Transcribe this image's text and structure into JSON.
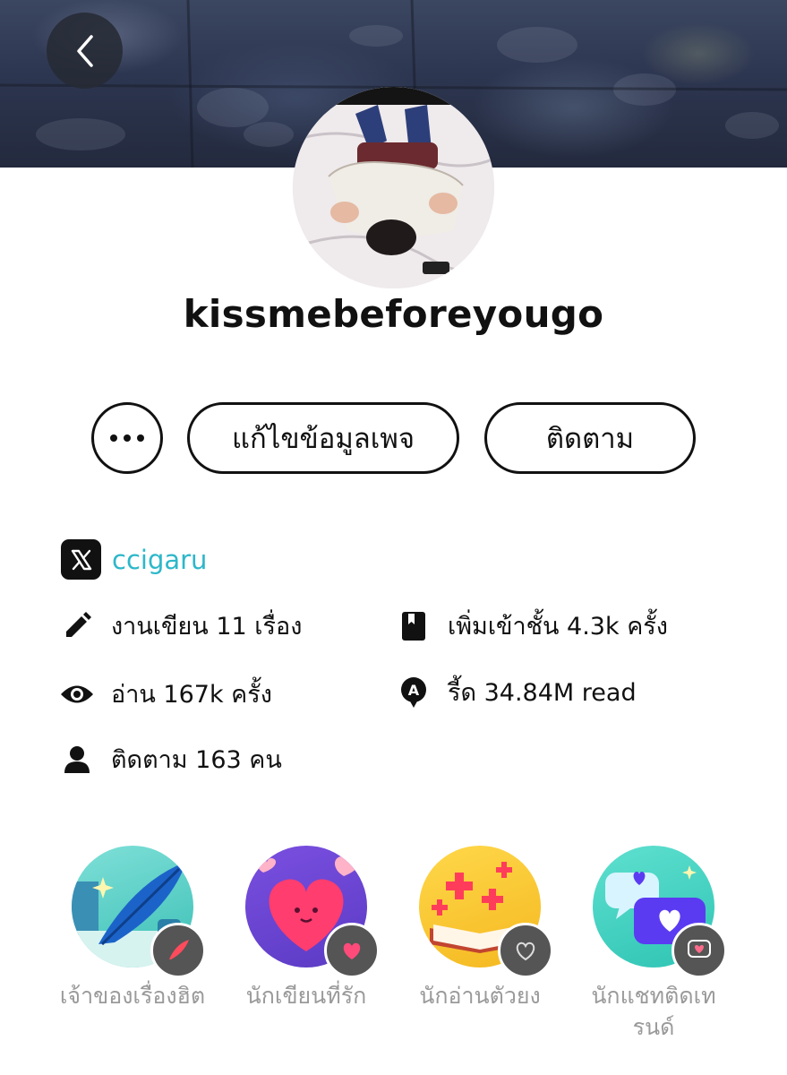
{
  "profile": {
    "username": "kissmebeforeyougo",
    "twitter_handle": "ccigaru"
  },
  "actions": {
    "edit_label": "แก้ไขข้อมูลเพจ",
    "follow_label": "ติดตาม"
  },
  "stats": {
    "works": "งานเขียน 11 เรื่อง",
    "shelf": "เพิ่มเข้าชั้น 4.3k ครั้ง",
    "reads": "อ่าน 167k ครั้ง",
    "read_count": "รี้ด 34.84M read",
    "followers": "ติดตาม 163 คน"
  },
  "badges": [
    {
      "label": "เจ้าของเรื่องฮิต",
      "icon": "quill-icon"
    },
    {
      "label": "นักเขียนที่รัก",
      "icon": "heart-icon"
    },
    {
      "label": "นักอ่านตัวยง",
      "icon": "book-icon"
    },
    {
      "label": "นักแชทติดเทรนด์",
      "icon": "chat-heart-icon"
    }
  ],
  "colors": {
    "link": "#2db7c9",
    "badge_label": "#9a9a9a"
  }
}
